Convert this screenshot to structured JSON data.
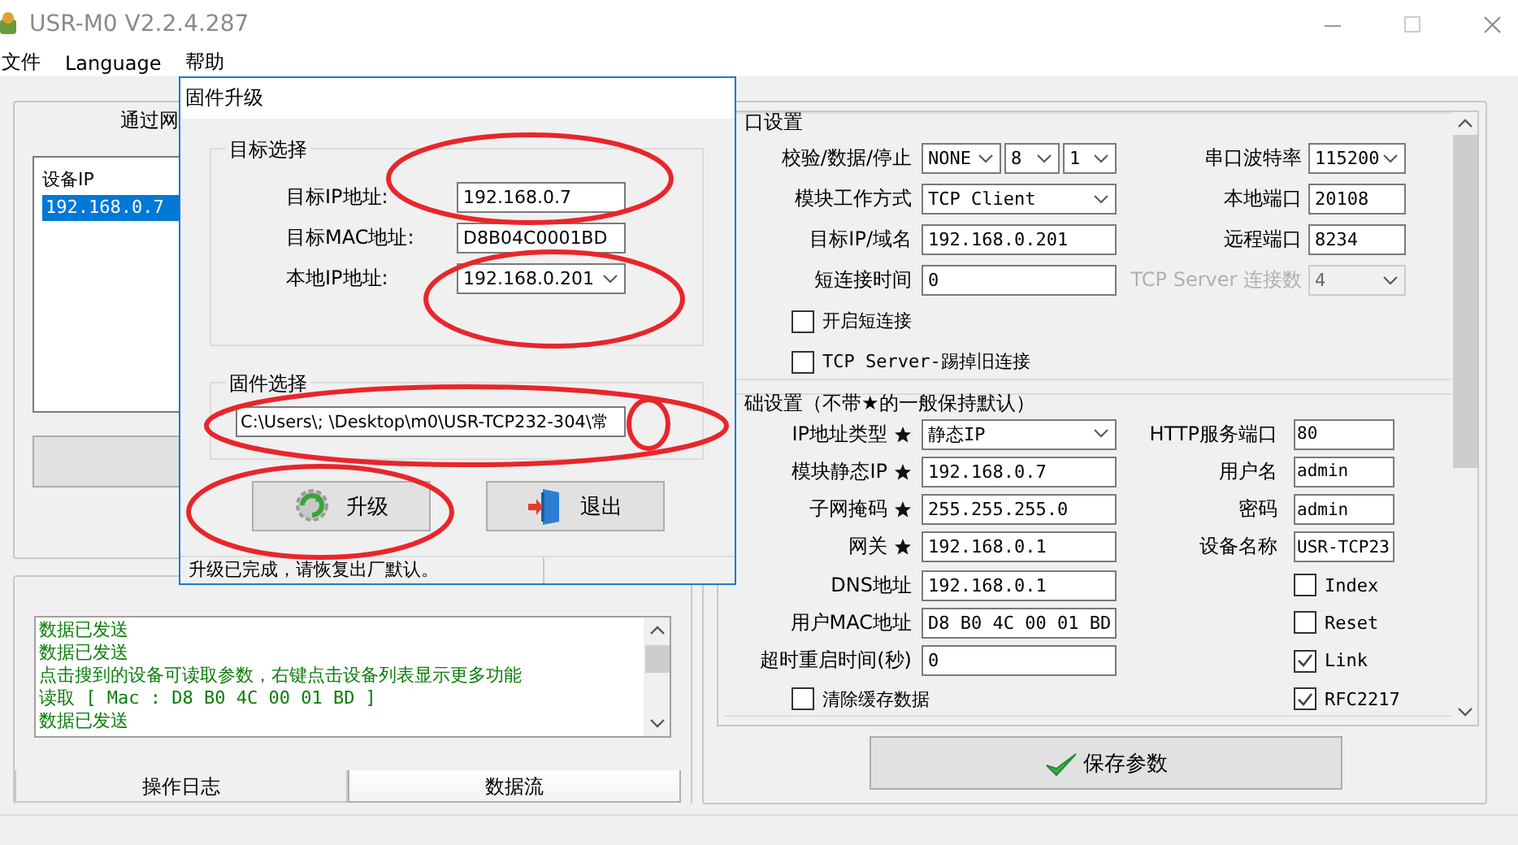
{
  "window": {
    "title": "USR-M0 V2.2.4.287"
  },
  "menu": [
    {
      "label": "文件"
    },
    {
      "label": "Language"
    },
    {
      "label": "帮助"
    }
  ],
  "device_panel": {
    "title": "通过网",
    "list": {
      "header": "设备IP",
      "rows": [
        {
          "ip": "192.168.0.7",
          "selected": true
        }
      ]
    }
  },
  "log_panel": {
    "lines": [
      "数据已发送",
      "数据已发送",
      "点击搜到的设备可读取参数，右键点击设备列表显示更多功能",
      "读取 [ Mac : D8 B0 4C 00 01 BD ]",
      "数据已发送"
    ],
    "tabs": [
      {
        "label": "操作日志",
        "selected": true
      },
      {
        "label": "数据流",
        "selected": false
      }
    ]
  },
  "settings": {
    "sections": [
      {
        "title": "口设置",
        "kind": "serial",
        "rows": [
          {
            "left": {
              "kind": "multi-select",
              "label": "校验/数据/停止",
              "values": [
                "NONE",
                "8",
                "1"
              ],
              "disabled": false
            },
            "right": {
              "kind": "select",
              "label": "串口波特率",
              "value": "115200",
              "disabled": false
            }
          },
          {
            "left": {
              "kind": "select",
              "label": "模块工作方式",
              "value": "TCP Client",
              "disabled": false
            },
            "right": {
              "kind": "input",
              "label": "本地端口",
              "value": "20108",
              "disabled": false
            }
          },
          {
            "left": {
              "kind": "input",
              "label": "目标IP/域名",
              "value": "192.168.0.201",
              "disabled": false
            },
            "right": {
              "kind": "input",
              "label": "远程端口",
              "value": "8234",
              "disabled": false
            }
          },
          {
            "left": {
              "kind": "input",
              "label": "短连接时间",
              "value": "0",
              "disabled": false
            },
            "right": {
              "kind": "select",
              "label": "TCP Server 连接数",
              "value": "4",
              "disabled": true
            }
          },
          {
            "left": {
              "kind": "checkbox",
              "label": "开启短连接",
              "checked": false
            }
          },
          {
            "left": {
              "kind": "checkbox",
              "label": "TCP Server-踢掉旧连接",
              "checked": false
            }
          }
        ]
      },
      {
        "title": "础设置（不带★的一般保持默认）",
        "kind": "basic",
        "rows": [
          {
            "left": {
              "kind": "select",
              "label": "IP地址类型",
              "starred": true,
              "value": "静态IP",
              "disabled": false
            },
            "right": {
              "kind": "input",
              "label": "HTTP服务端口",
              "value": "80",
              "disabled": false
            }
          },
          {
            "left": {
              "kind": "input",
              "label": "模块静态IP",
              "starred": true,
              "value": "192.168.0.7",
              "disabled": false
            },
            "right": {
              "kind": "input",
              "label": "用户名",
              "value": "admin",
              "disabled": false
            }
          },
          {
            "left": {
              "kind": "input",
              "label": "子网掩码",
              "starred": true,
              "value": "255.255.255.0",
              "disabled": false
            },
            "right": {
              "kind": "input",
              "label": "密码",
              "value": "admin",
              "disabled": false
            }
          },
          {
            "left": {
              "kind": "input",
              "label": "网关",
              "starred": true,
              "value": "192.168.0.1",
              "disabled": false
            },
            "right": {
              "kind": "input",
              "label": "设备名称",
              "value": "USR-TCP23",
              "disabled": false
            }
          },
          {
            "left": {
              "kind": "input",
              "label": "DNS地址",
              "starred": false,
              "value": "192.168.0.1",
              "disabled": false
            },
            "right": {
              "kind": "checkbox",
              "label": "Index",
              "checked": false
            }
          },
          {
            "left": {
              "kind": "input",
              "label": "用户MAC地址",
              "starred": false,
              "value": "D8 B0 4C 00 01 BD",
              "disabled": false
            },
            "right": {
              "kind": "checkbox",
              "label": "Reset",
              "checked": false
            }
          },
          {
            "left": {
              "kind": "input",
              "label": "超时重启时间(秒)",
              "starred": false,
              "value": "0",
              "disabled": false
            },
            "right": {
              "kind": "checkbox",
              "label": "Link",
              "checked": true
            }
          },
          {
            "left": {
              "kind": "checkbox",
              "label": "清除缓存数据",
              "checked": false
            },
            "right": {
              "kind": "checkbox",
              "label": "RFC2217",
              "checked": true
            }
          }
        ]
      }
    ],
    "save_button": "保存参数"
  },
  "dialog": {
    "title": "固件升级",
    "target_group": {
      "title": "目标选择",
      "fields": [
        {
          "kind": "input",
          "label": "目标IP地址:",
          "value": "192.168.0.7"
        },
        {
          "kind": "input",
          "label": "目标MAC地址:",
          "value": "D8B04C0001BD"
        },
        {
          "kind": "select",
          "label": "本地IP地址:",
          "value": "192.168.0.201"
        }
      ]
    },
    "firmware_group": {
      "title": "固件选择",
      "path": "C:\\Users\\;  \\Desktop\\m0\\USR-TCP232-304\\常"
    },
    "buttons": [
      {
        "label": "升级"
      },
      {
        "label": "退出"
      }
    ],
    "status": "升级已完成，请恢复出厂默认。"
  }
}
